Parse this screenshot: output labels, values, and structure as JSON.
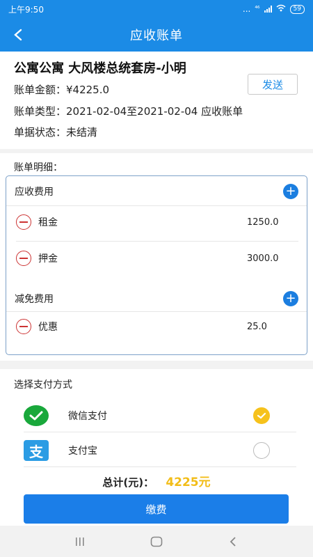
{
  "status_bar": {
    "time": "上午9:50",
    "dots": "...",
    "signal_text": "⁴⁶",
    "battery": "59"
  },
  "header": {
    "title": "应收账单"
  },
  "bill": {
    "title": "公寓公寓 大风楼总统套房-小明",
    "amount": "账单金额：¥4225.0",
    "type": "账单类型：2021-02-04至2021-02-04   应收账单",
    "status": "单据状态：未结清",
    "send_label": "发送"
  },
  "details": {
    "label": "账单明细：",
    "receivable_title": "应收费用",
    "receivable_items": [
      {
        "name": "租金",
        "amount": "1250.0"
      },
      {
        "name": "押金",
        "amount": "3000.0"
      }
    ],
    "discount_title": "减免费用",
    "discount_items": [
      {
        "name": "优惠",
        "amount": "25.0"
      }
    ]
  },
  "payment": {
    "label": "选择支付方式",
    "methods": [
      {
        "name": "微信支付",
        "selected": true,
        "icon": "wechat-pay-icon",
        "icon_text": ""
      },
      {
        "name": "支付宝",
        "selected": false,
        "icon": "alipay-icon",
        "icon_text": "支"
      }
    ],
    "total_label": "总计(元)：",
    "total_amount": "4225元",
    "pay_button": "缴费"
  },
  "colors": {
    "primary": "#1b8be6",
    "accent_yellow": "#f6c21c",
    "minus_red": "#cc3333"
  }
}
